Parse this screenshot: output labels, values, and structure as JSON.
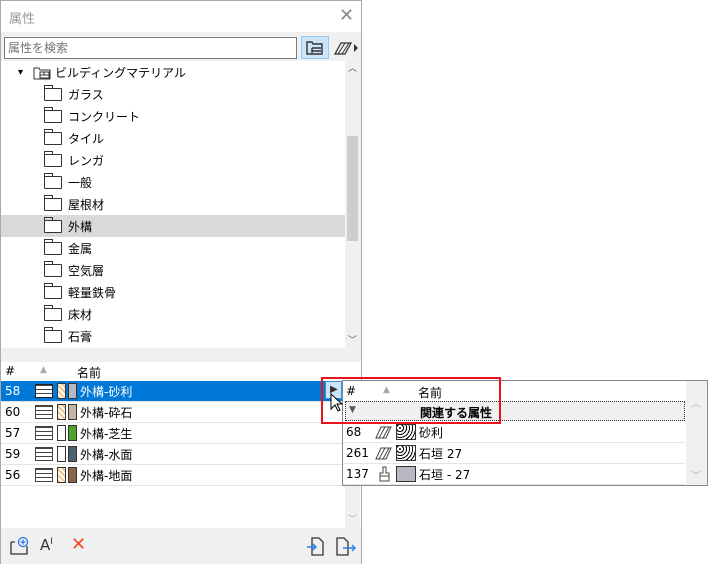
{
  "window": {
    "title": "属性"
  },
  "search": {
    "placeholder": "属性を検索"
  },
  "tree": {
    "root": "ビルディングマテリアル",
    "folders": [
      "ガラス",
      "コンクリート",
      "タイル",
      "レンガ",
      "一般",
      "屋根材",
      "外構",
      "金属",
      "空気層",
      "軽量鉄骨",
      "床材",
      "石膏"
    ],
    "selected": "外構"
  },
  "list": {
    "headers": {
      "num": "#",
      "name": "名前"
    },
    "rows": [
      {
        "num": "58",
        "name": "外構-砂利",
        "color": "#b8b8c4",
        "hatch": true,
        "selected": true
      },
      {
        "num": "60",
        "name": "外構-砕石",
        "color": "#c4b4a4",
        "hatch": true
      },
      {
        "num": "57",
        "name": "外構-芝生",
        "color": "#4ea42c",
        "hatch": false
      },
      {
        "num": "59",
        "name": "外構-水面",
        "color": "#4a6272",
        "hatch": false
      },
      {
        "num": "56",
        "name": "外構-地面",
        "color": "#8e6448",
        "hatch": true
      }
    ]
  },
  "popup": {
    "headers": {
      "num": "#",
      "name": "名前"
    },
    "group": "関連する属性",
    "rows": [
      {
        "num": "68",
        "name": "砂利",
        "type": "fill"
      },
      {
        "num": "261",
        "name": "石垣 27",
        "type": "fill"
      },
      {
        "num": "137",
        "name": "石垣 - 27",
        "type": "surface"
      }
    ]
  },
  "colors": {
    "selection": "#0078d7",
    "highlight": "#e8141b",
    "delete": "#f04a23"
  }
}
